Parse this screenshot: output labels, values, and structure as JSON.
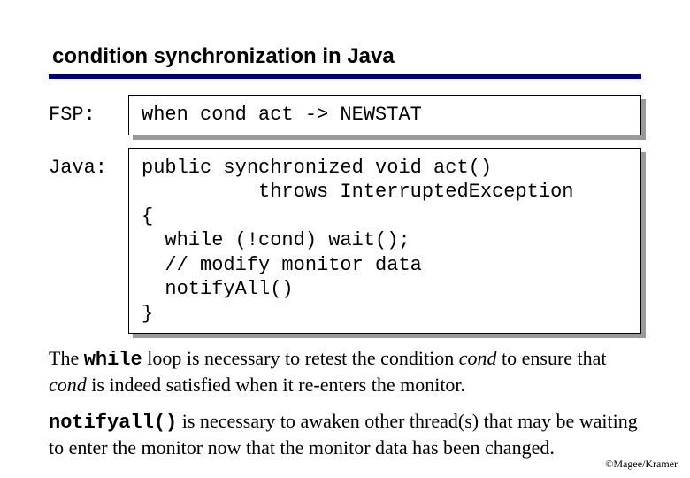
{
  "title": "condition synchronization in Java",
  "fsp": {
    "label": "FSP:",
    "code": "when cond act -> NEWSTAT"
  },
  "java": {
    "label": "Java:",
    "code": "public synchronized void act()\n          throws InterruptedException\n{\n  while (!cond) wait();\n  // modify monitor data\n  notifyAll()\n}"
  },
  "para1": {
    "pre": "The ",
    "code1": "while",
    "mid1": " loop is necessary to retest the condition ",
    "cond1": "cond",
    "mid2": " to ensure that ",
    "cond2": "cond",
    "post": " is indeed satisfied when it re-enters the monitor."
  },
  "para2": {
    "code": "notifyall()",
    "text": " is necessary to awaken other thread(s) that may be waiting to enter the monitor now that the monitor data has been changed."
  },
  "footer": "©Magee/Kramer"
}
